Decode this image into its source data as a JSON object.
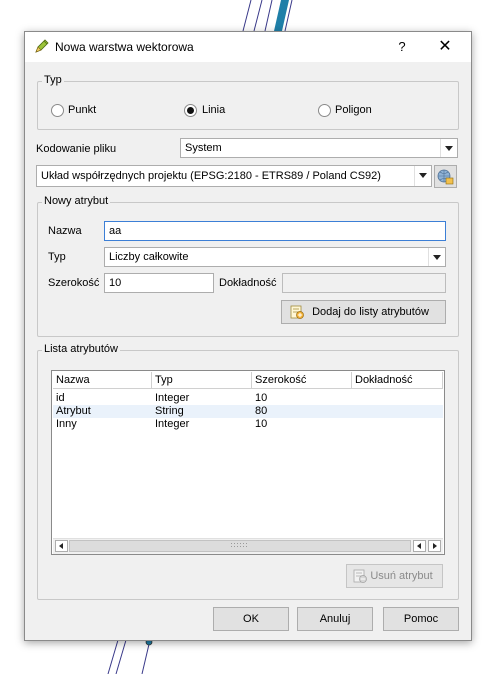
{
  "dialog": {
    "title": "Nowa warstwa wektorowa",
    "help_label": "?",
    "close_label": "✕"
  },
  "type_group": {
    "legend": "Typ",
    "options": [
      {
        "label": "Punkt",
        "checked": false
      },
      {
        "label": "Linia",
        "checked": true
      },
      {
        "label": "Poligon",
        "checked": false
      }
    ]
  },
  "encoding": {
    "label": "Kodowanie pliku",
    "value": "System"
  },
  "crs": {
    "value": "Układ współrzędnych projektu (EPSG:2180 - ETRS89 / Poland CS92)"
  },
  "new_attribute": {
    "legend": "Nowy atrybut",
    "name_label": "Nazwa",
    "name_value": "aa",
    "type_label": "Typ",
    "type_value": "Liczby całkowite",
    "width_label": "Szerokość",
    "width_value": "10",
    "precision_label": "Dokładność",
    "precision_value": "",
    "add_button": "Dodaj do listy atrybutów"
  },
  "attribute_list": {
    "legend": "Lista atrybutów",
    "columns": [
      "Nazwa",
      "Typ",
      "Szerokość",
      "Dokładność"
    ],
    "rows": [
      [
        "id",
        "Integer",
        "10",
        ""
      ],
      [
        "Atrybut",
        "String",
        "80",
        ""
      ],
      [
        "Inny",
        "Integer",
        "10",
        ""
      ]
    ],
    "remove_button": "Usuń atrybut"
  },
  "footer": {
    "ok": "OK",
    "cancel": "Anuluj",
    "help": "Pomoc"
  }
}
